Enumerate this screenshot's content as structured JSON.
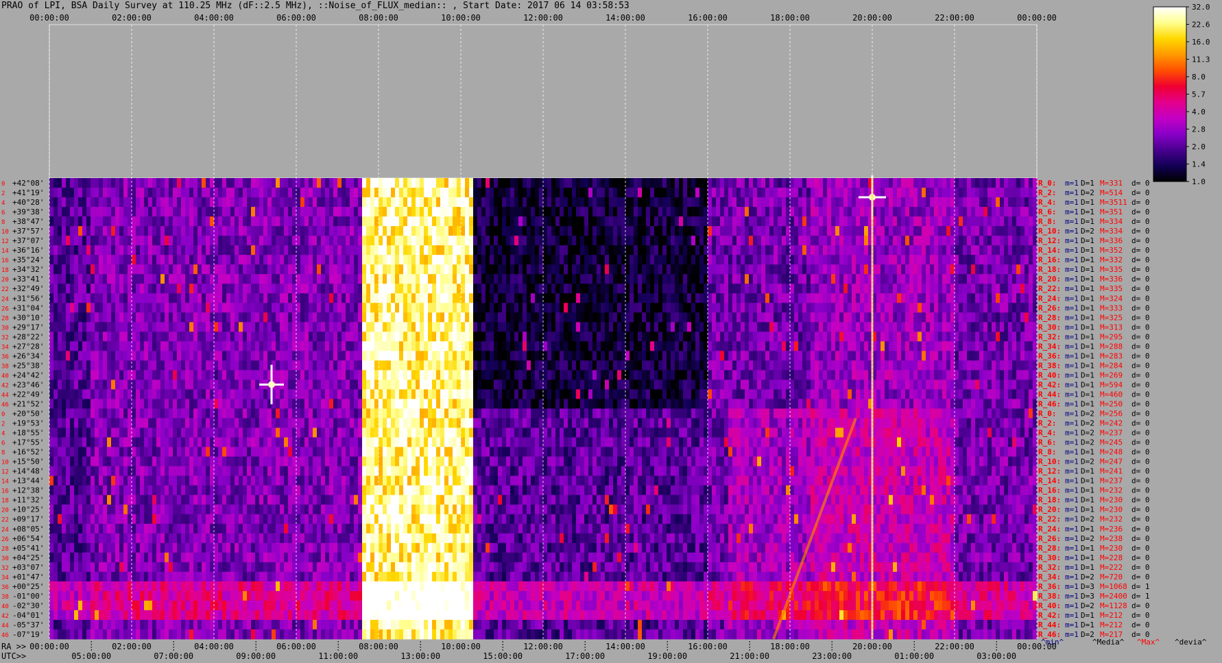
{
  "title": "PRAO of LPI, BSA Daily Survey at 110.25 MHz (dF::2.5 MHz), ::Noise_of_FLUX_median:: , Start Date: 2017 06 14 03:58:53",
  "chart_data": {
    "type": "heatmap",
    "title": "PRAO of LPI, BSA Daily Survey at 110.25 MHz (dF::2.5 MHz), ::Noise_of_FLUX_median:: , Start Date: 2017 06 14 03:58:53",
    "x_top_ticks": [
      "00:00:00",
      "02:00:00",
      "04:00:00",
      "06:00:00",
      "08:00:00",
      "10:00:00",
      "12:00:00",
      "14:00:00",
      "16:00:00",
      "18:00:00",
      "20:00:00",
      "22:00:00",
      "00:00:00"
    ],
    "x_ra_label": "RA >>",
    "x_ra_ticks": [
      "00:00:00",
      "02:00:00",
      "04:00:00",
      "06:00:00",
      "08:00:00",
      "10:00:00",
      "12:00:00",
      "14:00:00",
      "16:00:00",
      "18:00:00",
      "20:00:00",
      "22:00:00",
      "00:00:00"
    ],
    "x_utc_label": "UTC>>",
    "x_utc_ticks": [
      "05:00:00",
      "07:00:00",
      "09:00:00",
      "11:00:00",
      "13:00:00",
      "15:00:00",
      "17:00:00",
      "19:00:00",
      "21:00:00",
      "23:00:00",
      "01:00:00",
      "03:00:00"
    ],
    "row_indices": [
      "0",
      "2",
      "4",
      "6",
      "8",
      "10",
      "12",
      "14",
      "16",
      "18",
      "20",
      "22",
      "24",
      "26",
      "28",
      "30",
      "32",
      "34",
      "36",
      "38",
      "40",
      "42",
      "44",
      "46",
      "0",
      "2",
      "4",
      "6",
      "8",
      "10",
      "12",
      "14",
      "16",
      "18",
      "20",
      "22",
      "24",
      "26",
      "28",
      "30",
      "32",
      "34",
      "36",
      "38",
      "40",
      "42",
      "44",
      "46"
    ],
    "declinations": [
      "+42°08'",
      "+41°19'",
      "+40°28'",
      "+39°38'",
      "+38°47'",
      "+37°57'",
      "+37°07'",
      "+36°16'",
      "+35°24'",
      "+34°32'",
      "+33°41'",
      "+32°49'",
      "+31°56'",
      "+31°04'",
      "+30°10'",
      "+29°17'",
      "+28°22'",
      "+27°28'",
      "+26°34'",
      "+25°38'",
      "+24°42'",
      "+23°46'",
      "+22°49'",
      "+21°52'",
      "+20°50'",
      "+19°53'",
      "+18°55'",
      "+17°55'",
      "+16°52'",
      "+15°50'",
      "+14°48'",
      "+13°44'",
      "+12°38'",
      "+11°32'",
      "+10°25'",
      "+09°17'",
      "+08°05'",
      "+06°54'",
      "+05°41'",
      "+04°25'",
      "+03°07'",
      "+01°47'",
      "+00°25'",
      "-01°00'",
      "-02°30'",
      "-04°01'",
      "-05°37'",
      "-07°19'"
    ],
    "colorbar": {
      "ticks": [
        "32.0",
        "22.6",
        "16.0",
        "11.3",
        "8.0",
        "5.7",
        "4.0",
        "2.8",
        "2.0",
        "1.4",
        "1.0"
      ],
      "colors": [
        "#000000",
        "#120055",
        "#4a0090",
        "#8a00c8",
        "#c400c4",
        "#e4008a",
        "#f00030",
        "#ff5000",
        "#ff9a00",
        "#ffd800",
        "#ffff90",
        "#ffffff"
      ]
    },
    "stats": [
      {
        "r": "R_0:",
        "m": "m=1",
        "d": "D=1",
        "M": "M=331",
        "dv": "d= 0"
      },
      {
        "r": "R_2:",
        "m": "m=1",
        "d": "D=2",
        "M": "M=514",
        "dv": "d= 0"
      },
      {
        "r": "R_4:",
        "m": "m=1",
        "d": "D=1",
        "M": "M=3511",
        "dv": "d= 0"
      },
      {
        "r": "R_6:",
        "m": "m=1",
        "d": "D=1",
        "M": "M=351",
        "dv": "d= 0"
      },
      {
        "r": "R_8:",
        "m": "m=1",
        "d": "D=1",
        "M": "M=334",
        "dv": "d= 0"
      },
      {
        "r": "R_10:",
        "m": "m=1",
        "d": "D=2",
        "M": "M=334",
        "dv": "d= 0"
      },
      {
        "r": "R_12:",
        "m": "m=1",
        "d": "D=1",
        "M": "M=336",
        "dv": "d= 0"
      },
      {
        "r": "R_14:",
        "m": "m=1",
        "d": "D=1",
        "M": "M=352",
        "dv": "d= 0"
      },
      {
        "r": "R_16:",
        "m": "m=1",
        "d": "D=1",
        "M": "M=332",
        "dv": "d= 0"
      },
      {
        "r": "R_18:",
        "m": "m=1",
        "d": "D=1",
        "M": "M=335",
        "dv": "d= 0"
      },
      {
        "r": "R_20:",
        "m": "m=1",
        "d": "D=1",
        "M": "M=336",
        "dv": "d= 0"
      },
      {
        "r": "R_22:",
        "m": "m=1",
        "d": "D=1",
        "M": "M=335",
        "dv": "d= 0"
      },
      {
        "r": "R_24:",
        "m": "m=1",
        "d": "D=1",
        "M": "M=324",
        "dv": "d= 0"
      },
      {
        "r": "R_26:",
        "m": "m=1",
        "d": "D=1",
        "M": "M=333",
        "dv": "d= 0"
      },
      {
        "r": "R_28:",
        "m": "m=1",
        "d": "D=1",
        "M": "M=325",
        "dv": "d= 0"
      },
      {
        "r": "R_30:",
        "m": "m=1",
        "d": "D=1",
        "M": "M=313",
        "dv": "d= 0"
      },
      {
        "r": "R_32:",
        "m": "m=1",
        "d": "D=1",
        "M": "M=295",
        "dv": "d= 0"
      },
      {
        "r": "R_34:",
        "m": "m=1",
        "d": "D=1",
        "M": "M=288",
        "dv": "d= 0"
      },
      {
        "r": "R_36:",
        "m": "m=1",
        "d": "D=1",
        "M": "M=283",
        "dv": "d= 0"
      },
      {
        "r": "R_38:",
        "m": "m=1",
        "d": "D=1",
        "M": "M=284",
        "dv": "d= 0"
      },
      {
        "r": "R_40:",
        "m": "m=1",
        "d": "D=1",
        "M": "M=269",
        "dv": "d= 0"
      },
      {
        "r": "R_42:",
        "m": "m=1",
        "d": "D=1",
        "M": "M=594",
        "dv": "d= 0"
      },
      {
        "r": "R_44:",
        "m": "m=1",
        "d": "D=1",
        "M": "M=460",
        "dv": "d= 0"
      },
      {
        "r": "R_46:",
        "m": "m=1",
        "d": "D=1",
        "M": "M=250",
        "dv": "d= 0"
      },
      {
        "r": "R_0:",
        "m": "m=1",
        "d": "D=2",
        "M": "M=256",
        "dv": "d= 0"
      },
      {
        "r": "R_2:",
        "m": "m=1",
        "d": "D=2",
        "M": "M=242",
        "dv": "d= 0"
      },
      {
        "r": "R_4:",
        "m": "m=1",
        "d": "D=2",
        "M": "M=237",
        "dv": "d= 0"
      },
      {
        "r": "R_6:",
        "m": "m=1",
        "d": "D=2",
        "M": "M=245",
        "dv": "d= 0"
      },
      {
        "r": "R_8:",
        "m": "m=1",
        "d": "D=1",
        "M": "M=248",
        "dv": "d= 0"
      },
      {
        "r": "R_10:",
        "m": "m=1",
        "d": "D=2",
        "M": "M=247",
        "dv": "d= 0"
      },
      {
        "r": "R_12:",
        "m": "m=1",
        "d": "D=1",
        "M": "M=241",
        "dv": "d= 0"
      },
      {
        "r": "R_14:",
        "m": "m=1",
        "d": "D=1",
        "M": "M=237",
        "dv": "d= 0"
      },
      {
        "r": "R_16:",
        "m": "m=1",
        "d": "D=1",
        "M": "M=232",
        "dv": "d= 0"
      },
      {
        "r": "R_18:",
        "m": "m=1",
        "d": "D=1",
        "M": "M=230",
        "dv": "d= 0"
      },
      {
        "r": "R_20:",
        "m": "m=1",
        "d": "D=1",
        "M": "M=230",
        "dv": "d= 0"
      },
      {
        "r": "R_22:",
        "m": "m=1",
        "d": "D=2",
        "M": "M=232",
        "dv": "d= 0"
      },
      {
        "r": "R_24:",
        "m": "m=1",
        "d": "D=1",
        "M": "M=236",
        "dv": "d= 0"
      },
      {
        "r": "R_26:",
        "m": "m=1",
        "d": "D=2",
        "M": "M=238",
        "dv": "d= 0"
      },
      {
        "r": "R_28:",
        "m": "m=1",
        "d": "D=1",
        "M": "M=230",
        "dv": "d= 0"
      },
      {
        "r": "R_30:",
        "m": "m=1",
        "d": "D=1",
        "M": "M=228",
        "dv": "d= 0"
      },
      {
        "r": "R_32:",
        "m": "m=1",
        "d": "D=1",
        "M": "M=222",
        "dv": "d= 0"
      },
      {
        "r": "R_34:",
        "m": "m=1",
        "d": "D=2",
        "M": "M=720",
        "dv": "d= 0"
      },
      {
        "r": "R_36:",
        "m": "m=1",
        "d": "D=3",
        "M": "M=1068",
        "dv": "d= 1"
      },
      {
        "r": "R_38:",
        "m": "m=1",
        "d": "D=3",
        "M": "M=2400",
        "dv": "d= 1"
      },
      {
        "r": "R_40:",
        "m": "m=1",
        "d": "D=2",
        "M": "M=1128",
        "dv": "d= 0"
      },
      {
        "r": "R_42:",
        "m": "m=1",
        "d": "D=1",
        "M": "M=212",
        "dv": "d= 0"
      },
      {
        "r": "R_44:",
        "m": "m=1",
        "d": "D=1",
        "M": "M=212",
        "dv": "d= 0"
      },
      {
        "r": "R_46:",
        "m": "m=1",
        "d": "D=2",
        "M": "M=217",
        "dv": "d= 0"
      }
    ],
    "footer_labels": [
      "^min^",
      "^Media^",
      "^Max^",
      "^devia^"
    ],
    "colors": {
      "minimum": "#000080",
      "median": "#000000",
      "maximum": "#ff0000",
      "deviation": "#000000",
      "row_index": "#ff0000",
      "background": "#a9a9a9"
    }
  }
}
